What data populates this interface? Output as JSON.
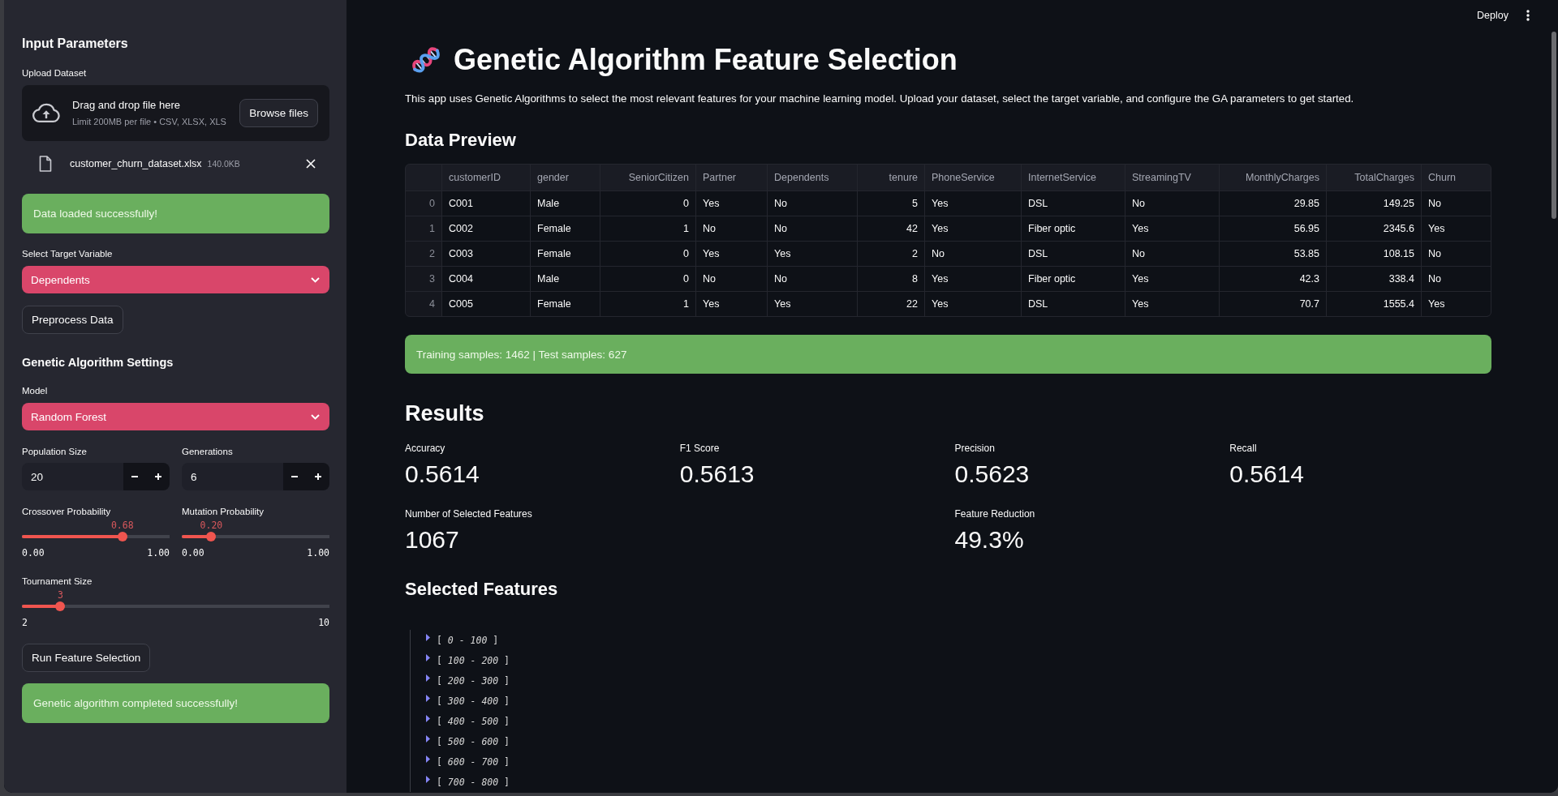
{
  "header": {
    "deploy_button": "Deploy"
  },
  "sidebar": {
    "title": "Input Parameters",
    "upload": {
      "label": "Upload Dataset",
      "prompt": "Drag and drop file here",
      "limit": "Limit 200MB per file • CSV, XLSX, XLS",
      "button": "Browse files",
      "file": {
        "name": "customer_churn_dataset.xlsx",
        "size": "140.0KB"
      }
    },
    "upload_alert": {
      "kind": "success",
      "text": "Data loaded successfully!"
    },
    "target": {
      "label": "Select Target Variable",
      "value": "Dependents"
    },
    "preprocess_button": "Preprocess Data",
    "settings_title": "Genetic Algorithm Settings",
    "model": {
      "label": "Model",
      "value": "Random Forest"
    },
    "number_inputs": [
      {
        "label": "Population Size",
        "value": "20"
      },
      {
        "label": "Generations",
        "value": "6"
      }
    ],
    "probability_sliders": [
      {
        "label": "Crossover Probability",
        "reading": "0.68",
        "level": 0.68,
        "min": "0.00",
        "max": "1.00"
      },
      {
        "label": "Mutation Probability",
        "reading": "0.20",
        "level": 0.2,
        "min": "0.00",
        "max": "1.00"
      }
    ],
    "tournament_slider": {
      "label": "Tournament Size",
      "reading": "3",
      "level": 0.125,
      "min": "2",
      "max": "10"
    },
    "run_button": "Run Feature Selection",
    "run_alert": {
      "kind": "success",
      "text": "Genetic algorithm completed successfully!"
    }
  },
  "main": {
    "title": "Genetic Algorithm Feature Selection",
    "description": "This app uses Genetic Algorithms to select the most relevant features for your machine learning model. Upload your dataset, select the target variable, and configure the GA parameters to get started.",
    "preview_heading": "Data Preview",
    "table": {
      "columns": [
        {
          "label": "customerID",
          "kind": "text"
        },
        {
          "label": "gender",
          "kind": "text"
        },
        {
          "label": "SeniorCitizen",
          "kind": "number"
        },
        {
          "label": "Partner",
          "kind": "text"
        },
        {
          "label": "Dependents",
          "kind": "text"
        },
        {
          "label": "tenure",
          "kind": "number"
        },
        {
          "label": "PhoneService",
          "kind": "text"
        },
        {
          "label": "InternetService",
          "kind": "text"
        },
        {
          "label": "StreamingTV",
          "kind": "text"
        },
        {
          "label": "MonthlyCharges",
          "kind": "number"
        },
        {
          "label": "TotalCharges",
          "kind": "number"
        },
        {
          "label": "Churn",
          "kind": "text"
        }
      ],
      "rows": [
        {
          "index": "0",
          "cells": [
            "C001",
            "Male",
            "0",
            "Yes",
            "No",
            "5",
            "Yes",
            "DSL",
            "No",
            "29.85",
            "149.25",
            "No"
          ]
        },
        {
          "index": "1",
          "cells": [
            "C002",
            "Female",
            "1",
            "No",
            "No",
            "42",
            "Yes",
            "Fiber optic",
            "Yes",
            "56.95",
            "2345.6",
            "Yes"
          ]
        },
        {
          "index": "2",
          "cells": [
            "C003",
            "Female",
            "0",
            "Yes",
            "Yes",
            "2",
            "No",
            "DSL",
            "No",
            "53.85",
            "108.15",
            "No"
          ]
        },
        {
          "index": "3",
          "cells": [
            "C004",
            "Male",
            "0",
            "No",
            "No",
            "8",
            "Yes",
            "Fiber optic",
            "Yes",
            "42.3",
            "338.4",
            "No"
          ]
        },
        {
          "index": "4",
          "cells": [
            "C005",
            "Female",
            "1",
            "Yes",
            "Yes",
            "22",
            "Yes",
            "DSL",
            "Yes",
            "70.7",
            "1555.4",
            "Yes"
          ]
        }
      ]
    },
    "split_alert": {
      "kind": "success",
      "text": "Training samples: 1462 | Test samples: 627"
    },
    "results_heading": "Results",
    "metric_rows": [
      [
        {
          "label": "Accuracy",
          "value": "0.5614"
        },
        {
          "label": "F1 Score",
          "value": "0.5613"
        },
        {
          "label": "Precision",
          "value": "0.5623"
        },
        {
          "label": "Recall",
          "value": "0.5614"
        }
      ],
      [
        {
          "label": "Number of Selected Features",
          "value": "1067"
        },
        {
          "label": "Feature Reduction",
          "value": "49.3%"
        }
      ]
    ],
    "features_heading": "Selected Features",
    "feature_groups": [
      {
        "label": "[ *0 - 100* ]",
        "expanded": false
      },
      {
        "label": "[ *100 - 200* ]",
        "expanded": false
      },
      {
        "label": "[ *200 - 300* ]",
        "expanded": false
      },
      {
        "label": "[ *300 - 400* ]",
        "expanded": false
      },
      {
        "label": "[ *400 - 500* ]",
        "expanded": false
      },
      {
        "label": "[ *500 - 600* ]",
        "expanded": false
      },
      {
        "label": "[ *600 - 700* ]",
        "expanded": false
      },
      {
        "label": "[ *700 - 800* ]",
        "expanded": false
      }
    ]
  }
}
